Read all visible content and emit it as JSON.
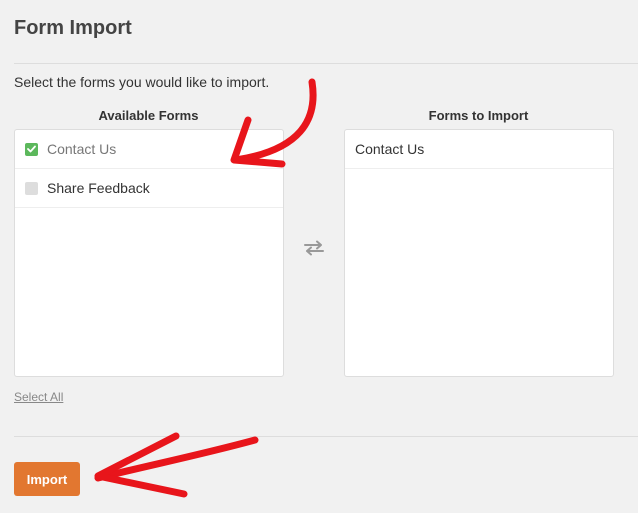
{
  "page": {
    "title": "Form Import",
    "instructions": "Select the forms you would like to import."
  },
  "available": {
    "heading": "Available Forms",
    "items": [
      {
        "label": "Contact Us",
        "checked": true
      },
      {
        "label": "Share Feedback",
        "checked": false
      }
    ],
    "select_all_label": "Select All"
  },
  "to_import": {
    "heading": "Forms to Import",
    "items": [
      {
        "label": "Contact Us"
      }
    ]
  },
  "actions": {
    "import_label": "Import"
  },
  "icons": {
    "swap": "swap-arrows-icon",
    "check": "checkmark-icon"
  },
  "colors": {
    "accent": "#e27730",
    "check": "#5cb85c",
    "annotation": "#e8151b"
  }
}
